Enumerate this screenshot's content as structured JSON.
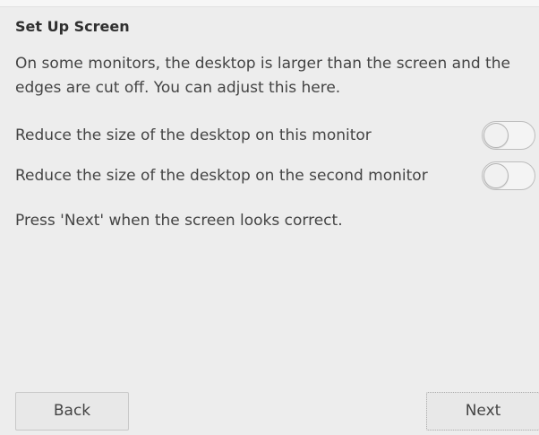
{
  "dialog": {
    "title": "Set Up Screen",
    "description": "On some monitors, the desktop is larger than the screen and the edges are cut off. You can adjust this here.",
    "options": [
      {
        "label": "Reduce the size of the desktop on this monitor",
        "enabled": false
      },
      {
        "label": "Reduce the size of the desktop on the second monitor",
        "enabled": false
      }
    ],
    "note": "Press 'Next' when the screen looks correct."
  },
  "buttons": {
    "back_label": "Back",
    "next_label": "Next"
  }
}
